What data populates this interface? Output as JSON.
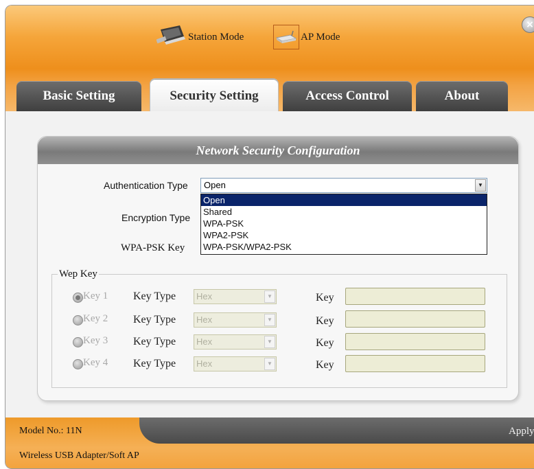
{
  "header": {
    "station_mode_label": "Station Mode",
    "ap_mode_label": "AP Mode"
  },
  "tabs": [
    {
      "label": "Basic Setting",
      "active": false
    },
    {
      "label": "Security Setting",
      "active": true
    },
    {
      "label": "Access Control",
      "active": false
    },
    {
      "label": "About",
      "active": false
    }
  ],
  "panel": {
    "title": "Network Security Configuration",
    "auth_type_label": "Authentication Type",
    "auth_type_value": "Open",
    "auth_options": [
      "Open",
      "Shared",
      "WPA-PSK",
      "WPA2-PSK",
      "WPA-PSK/WPA2-PSK"
    ],
    "encryption_type_label": "Encryption Type",
    "wpa_psk_key_label": "WPA-PSK Key"
  },
  "wep": {
    "legend": "Wep Key",
    "rows": [
      {
        "radio_label": "Key 1",
        "checked": true,
        "key_type_label": "Key Type",
        "key_type_value": "Hex",
        "key_label": "Key",
        "key_value": ""
      },
      {
        "radio_label": "Key 2",
        "checked": false,
        "key_type_label": "Key Type",
        "key_type_value": "Hex",
        "key_label": "Key",
        "key_value": ""
      },
      {
        "radio_label": "Key 3",
        "checked": false,
        "key_type_label": "Key Type",
        "key_type_value": "Hex",
        "key_label": "Key",
        "key_value": ""
      },
      {
        "radio_label": "Key 4",
        "checked": false,
        "key_type_label": "Key Type",
        "key_type_value": "Hex",
        "key_label": "Key",
        "key_value": ""
      }
    ]
  },
  "footer": {
    "model_label": "Model No.: 11N",
    "apply_label": "Apply",
    "adapter_label": "Wireless USB Adapter/Soft AP"
  },
  "colors": {
    "accent_orange": "#f5a53a",
    "tab_gray": "#4f4f4f",
    "selection_blue": "#0a246a"
  }
}
